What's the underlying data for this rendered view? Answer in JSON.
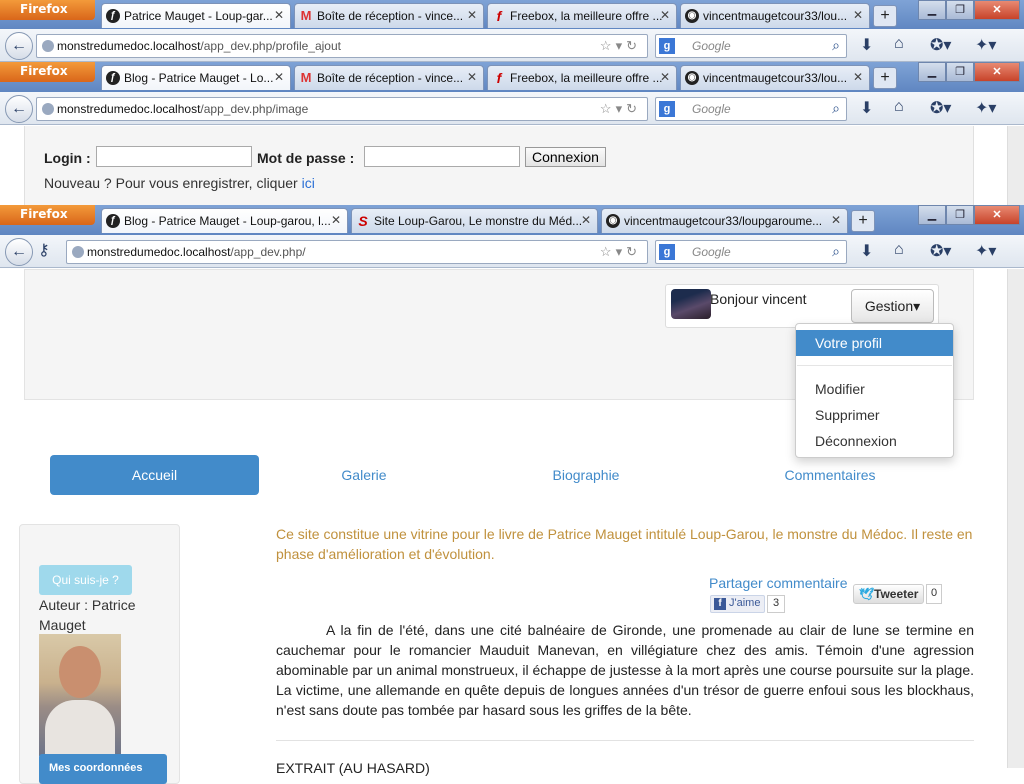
{
  "browser": {
    "firefox_label": "Firefox",
    "window1": {
      "tabs": [
        "Patrice Mauget - Loup-gar...",
        "Boîte de réception - vince...",
        "Freebox, la meilleure offre ...",
        "vincentmaugetcour33/lou..."
      ],
      "url_host": "monstredumedoc.localhost",
      "url_path": "/app_dev.php/profile_ajout",
      "search_placeholder": "Google"
    },
    "window2": {
      "tabs": [
        "Blog - Patrice Mauget - Lo...",
        "Boîte de réception - vince...",
        "Freebox, la meilleure offre ...",
        "vincentmaugetcour33/lou..."
      ],
      "url_host": "monstredumedoc.localhost",
      "url_path": "/app_dev.php/image",
      "search_placeholder": "Google"
    },
    "window3": {
      "tabs": [
        "Blog - Patrice Mauget - Loup-garou, l...",
        "Site Loup-Garou, Le monstre du Méd...",
        "vincentmaugetcour33/loupgaroume..."
      ],
      "url_host": "monstredumedoc.localhost",
      "url_path": "/app_dev.php/",
      "search_placeholder": "Google"
    }
  },
  "login": {
    "login_label": "Login :",
    "password_label": "Mot de passe :",
    "submit_label": "Connexion",
    "register_text": "Nouveau ? Pour vous enregistrer, cliquer",
    "register_link": "ici"
  },
  "header": {
    "greeting": "Bonjour vincent",
    "gestion_label": "Gestion",
    "menu": [
      "Votre profil",
      "Modifier",
      "Supprimer",
      "Déconnexion"
    ]
  },
  "nav": [
    "Accueil",
    "Galerie",
    "Biographie",
    "Commentaires"
  ],
  "sidebar": {
    "who_button": "Qui suis-je ?",
    "author": "Auteur : Patrice Mauget",
    "contact_button": "Mes coordonnées"
  },
  "main": {
    "intro": "Ce site constitue une vitrine pour le livre de Patrice Mauget intitulé Loup-Garou, le monstre du Médoc. Il reste en phase d'amélioration et d'évolution.",
    "share_label": "Partager commentaire",
    "like_label": "J'aime",
    "like_count": "3",
    "tweet_label": "Tweeter",
    "tweet_count": "0",
    "story": "A la fin de l'été, dans une cité balnéaire de Gironde, une promenade au clair de lune se termine en cauchemar pour le romancier Mauduit Manevan, en villégiature chez des amis. Témoin d'une agression abominable par un animal monstrueux, il échappe de justesse à la mort après une course poursuite sur la plage. La victime, une allemande en quête depuis de longues années d'un trésor de guerre enfoui sous les blockhaus, n'est sans doute pas tombée par hasard sous les griffes de la bête.",
    "extract_heading": "EXTRAIT (AU HASARD)"
  }
}
